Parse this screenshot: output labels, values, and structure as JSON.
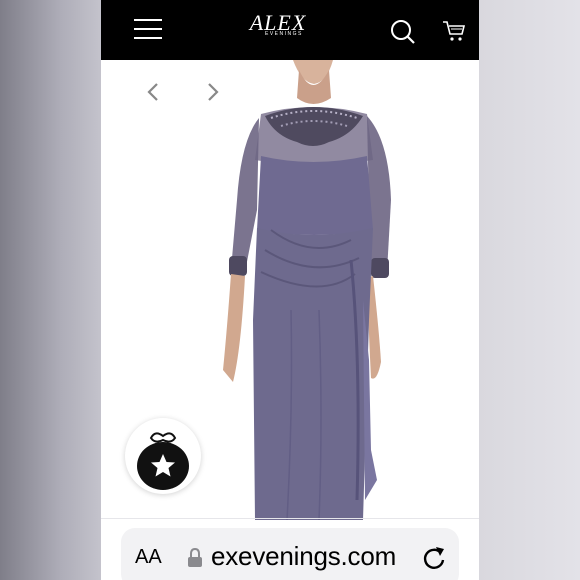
{
  "browser": {
    "text_size_label": "AA",
    "url": "exevenings.com",
    "lock_icon": "lock-icon",
    "reload_icon": "reload-icon"
  },
  "header": {
    "menu_icon": "hamburger-menu-icon",
    "logo_script": "Alex",
    "logo_sub": "EVENINGS",
    "search_icon": "search-icon",
    "cart_icon": "cart-icon",
    "background": "#000000",
    "foreground": "#ffffff"
  },
  "gallery": {
    "prev_icon": "chevron-left-icon",
    "next_icon": "chevron-right-icon",
    "dress_color": "#6e6a8e"
  },
  "badge": {
    "icon": "favorite-star-bag-icon"
  }
}
